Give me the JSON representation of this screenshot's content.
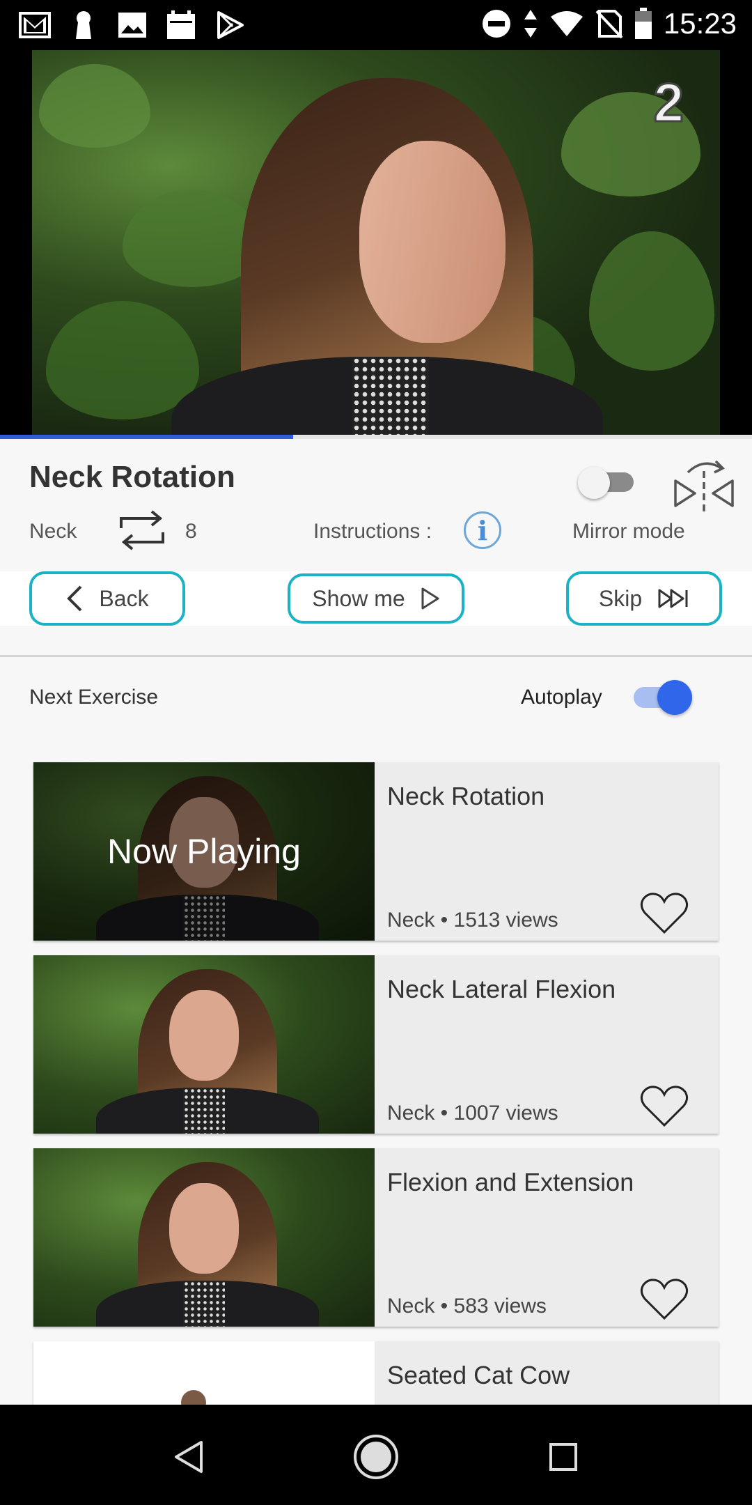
{
  "status_bar": {
    "time": "15:23",
    "left_icons": [
      "gmail-icon",
      "keyhole-icon",
      "gallery-icon",
      "calendar-icon",
      "play-store-icon"
    ],
    "right_icons": [
      "do-not-disturb-icon",
      "data-arrows-icon",
      "wifi-icon",
      "no-sim-icon",
      "battery-icon"
    ]
  },
  "video": {
    "counter": "2",
    "progress": 0.39
  },
  "exercise": {
    "title": "Neck Rotation",
    "category": "Neck",
    "reps": "8",
    "instructions_label": "Instructions :",
    "mirror_label": "Mirror mode",
    "mirror_on": false
  },
  "buttons": {
    "back": "Back",
    "show_me": "Show me",
    "skip": "Skip"
  },
  "next": {
    "label": "Next Exercise",
    "autoplay_label": "Autoplay",
    "autoplay_on": true
  },
  "list": [
    {
      "title": "Neck Rotation",
      "meta": "Neck • 1513 views",
      "overlay": "Now Playing"
    },
    {
      "title": "Neck Lateral Flexion",
      "meta": "Neck • 1007 views"
    },
    {
      "title": "Flexion and Extension",
      "meta": "Neck • 583 views"
    },
    {
      "title": "Seated Cat Cow",
      "meta": ""
    }
  ],
  "colors": {
    "accent": "#1ab2c4",
    "progress": "#2f5fd8",
    "toggle_on": "#2f66ea"
  }
}
